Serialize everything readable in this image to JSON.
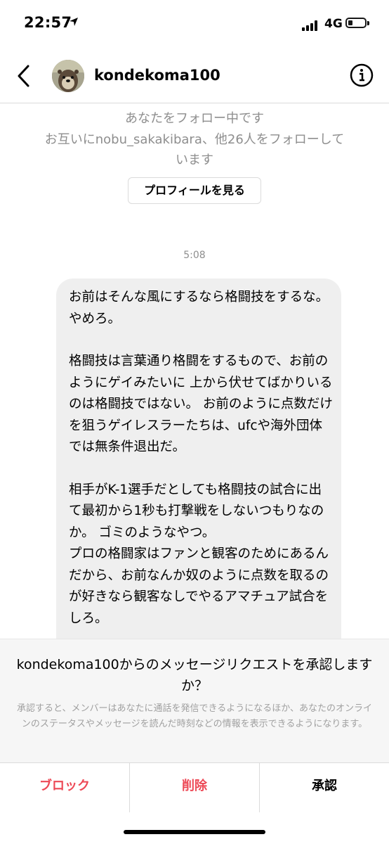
{
  "status_bar": {
    "time": "22:57",
    "network": "4G",
    "battery_level": 0.2
  },
  "header": {
    "username": "kondekoma100"
  },
  "profile_info": {
    "following_you": "あなたをフォロー中です",
    "mutual_line1": "お互いにnobu_sakakibara、他26人をフォローして",
    "mutual_line2": "います",
    "view_profile_label": "プロフィールを見る"
  },
  "conversation": {
    "timestamp": "5:08",
    "message": {
      "paragraph1": "お前はそんな風にするなら格闘技をするな。 やめろ。",
      "paragraph2": "格闘技は言葉通り格闘をするもので、お前のようにゲイみたいに 上から伏せてばかりいるのは格闘技ではない。 お前のように点数だけを狙うゲイレスラーたちは、ufcや海外団体では無条件退出だ。",
      "paragraph3a": "相手がK-1選手だとしても格闘技の試合に出て最初から1秒も打撃戦をしないつもりなのか。 ゴミのようなやつ。",
      "paragraph3b": "プロの格闘家はファンと観客のためにあるんだから、お前なんか奴のように点数を取るのが好きなら観客なしでやるアマチュア試合をしろ。"
    }
  },
  "request_sheet": {
    "title": "kondekoma100からのメッセージリクエストを承認しますか？",
    "description": "承認すると、メンバーはあなたに通話を発信できるようになるほか、あなたのオンラインのステータスやメッセージを読んだ時刻などの情報を表示できるようになります。"
  },
  "actions": {
    "block": "ブロック",
    "delete": "削除",
    "accept": "承認"
  },
  "colors": {
    "destructive": "#ed4956",
    "secondary_text": "#8e8e8e",
    "bubble": "#efefef"
  },
  "icons": {
    "back": "chevron-left-icon",
    "info": "info-circle-icon",
    "location": "location-arrow-icon"
  }
}
